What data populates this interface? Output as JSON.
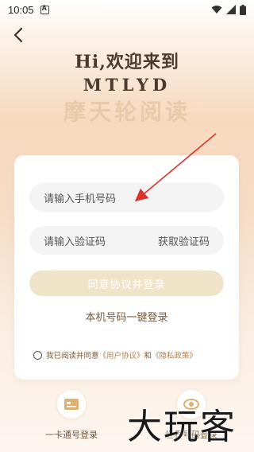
{
  "status_bar": {
    "time": "10:05"
  },
  "hero": {
    "greeting": "Hi,欢迎来到",
    "brand": "MTLYD",
    "app_name": "摩天轮阅读"
  },
  "form": {
    "phone_placeholder": "请输入手机号码",
    "code_placeholder": "请输入验证码",
    "get_code_label": "获取验证码",
    "login_button": "同意协议并登录",
    "one_click_login": "本机号码一键登录"
  },
  "agreement": {
    "prefix": "我已阅读并同意",
    "user_agreement": "《用户协议》",
    "and": "和",
    "privacy_policy": "《隐私政策》"
  },
  "alt_logins": [
    {
      "label": "一卡通号登录",
      "icon": "id-card-icon"
    },
    {
      "label": "世界号码登录",
      "icon": "globe-icon"
    }
  ],
  "watermark": "大玩客",
  "colors": {
    "accent": "#b08050",
    "login_button_bg": "#f0e4c8",
    "arrow": "#d9342b"
  }
}
